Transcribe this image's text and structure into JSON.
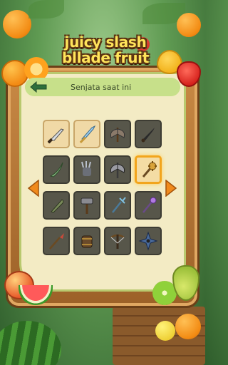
{
  "game": {
    "title_line1": "juicy slash",
    "title_line2": "bllade fruit"
  },
  "panel": {
    "header_title": "Senjata saat ini",
    "back_icon": "arrow-left-icon",
    "prev_icon": "chevron-left-icon",
    "next_icon": "chevron-right-icon"
  },
  "colors": {
    "frame_wood": "#b07438",
    "panel_cream": "#f3ebc4",
    "header_green": "#c7e08a",
    "locked_slot": "#57564a",
    "unlocked_slot": "#f0d9a6",
    "selected_border": "#f2a51d",
    "arrow_orange": "#f08a1c"
  },
  "weapons": [
    {
      "icon": "knife-icon",
      "state": "unlocked"
    },
    {
      "icon": "broadsword-icon",
      "state": "unlocked"
    },
    {
      "icon": "battle-axe-icon",
      "state": "locked"
    },
    {
      "icon": "dagger-icon",
      "state": "locked"
    },
    {
      "icon": "curved-blade-icon",
      "state": "locked"
    },
    {
      "icon": "claw-gauntlet-icon",
      "state": "locked"
    },
    {
      "icon": "double-axe-icon",
      "state": "locked"
    },
    {
      "icon": "mace-icon",
      "state": "selected"
    },
    {
      "icon": "machete-icon",
      "state": "locked"
    },
    {
      "icon": "hammer-icon",
      "state": "locked"
    },
    {
      "icon": "trident-icon",
      "state": "locked"
    },
    {
      "icon": "magic-staff-icon",
      "state": "locked"
    },
    {
      "icon": "spear-icon",
      "state": "locked"
    },
    {
      "icon": "war-drum-icon",
      "state": "locked"
    },
    {
      "icon": "crossbow-icon",
      "state": "locked"
    },
    {
      "icon": "shuriken-icon",
      "state": "locked"
    }
  ]
}
